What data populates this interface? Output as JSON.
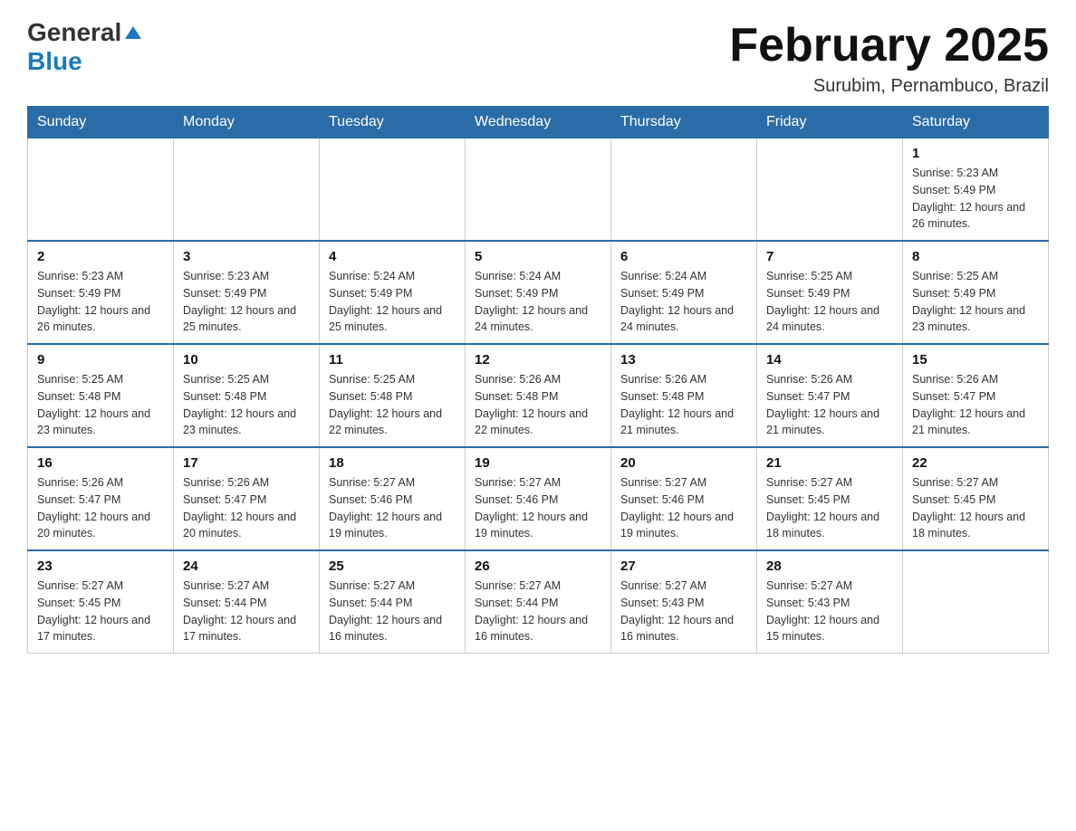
{
  "header": {
    "logo": {
      "general": "General",
      "blue": "Blue"
    },
    "title": "February 2025",
    "location": "Surubim, Pernambuco, Brazil"
  },
  "weekdays": [
    "Sunday",
    "Monday",
    "Tuesday",
    "Wednesday",
    "Thursday",
    "Friday",
    "Saturday"
  ],
  "weeks": [
    [
      {
        "day": "",
        "info": ""
      },
      {
        "day": "",
        "info": ""
      },
      {
        "day": "",
        "info": ""
      },
      {
        "day": "",
        "info": ""
      },
      {
        "day": "",
        "info": ""
      },
      {
        "day": "",
        "info": ""
      },
      {
        "day": "1",
        "info": "Sunrise: 5:23 AM\nSunset: 5:49 PM\nDaylight: 12 hours and 26 minutes."
      }
    ],
    [
      {
        "day": "2",
        "info": "Sunrise: 5:23 AM\nSunset: 5:49 PM\nDaylight: 12 hours and 26 minutes."
      },
      {
        "day": "3",
        "info": "Sunrise: 5:23 AM\nSunset: 5:49 PM\nDaylight: 12 hours and 25 minutes."
      },
      {
        "day": "4",
        "info": "Sunrise: 5:24 AM\nSunset: 5:49 PM\nDaylight: 12 hours and 25 minutes."
      },
      {
        "day": "5",
        "info": "Sunrise: 5:24 AM\nSunset: 5:49 PM\nDaylight: 12 hours and 24 minutes."
      },
      {
        "day": "6",
        "info": "Sunrise: 5:24 AM\nSunset: 5:49 PM\nDaylight: 12 hours and 24 minutes."
      },
      {
        "day": "7",
        "info": "Sunrise: 5:25 AM\nSunset: 5:49 PM\nDaylight: 12 hours and 24 minutes."
      },
      {
        "day": "8",
        "info": "Sunrise: 5:25 AM\nSunset: 5:49 PM\nDaylight: 12 hours and 23 minutes."
      }
    ],
    [
      {
        "day": "9",
        "info": "Sunrise: 5:25 AM\nSunset: 5:48 PM\nDaylight: 12 hours and 23 minutes."
      },
      {
        "day": "10",
        "info": "Sunrise: 5:25 AM\nSunset: 5:48 PM\nDaylight: 12 hours and 23 minutes."
      },
      {
        "day": "11",
        "info": "Sunrise: 5:25 AM\nSunset: 5:48 PM\nDaylight: 12 hours and 22 minutes."
      },
      {
        "day": "12",
        "info": "Sunrise: 5:26 AM\nSunset: 5:48 PM\nDaylight: 12 hours and 22 minutes."
      },
      {
        "day": "13",
        "info": "Sunrise: 5:26 AM\nSunset: 5:48 PM\nDaylight: 12 hours and 21 minutes."
      },
      {
        "day": "14",
        "info": "Sunrise: 5:26 AM\nSunset: 5:47 PM\nDaylight: 12 hours and 21 minutes."
      },
      {
        "day": "15",
        "info": "Sunrise: 5:26 AM\nSunset: 5:47 PM\nDaylight: 12 hours and 21 minutes."
      }
    ],
    [
      {
        "day": "16",
        "info": "Sunrise: 5:26 AM\nSunset: 5:47 PM\nDaylight: 12 hours and 20 minutes."
      },
      {
        "day": "17",
        "info": "Sunrise: 5:26 AM\nSunset: 5:47 PM\nDaylight: 12 hours and 20 minutes."
      },
      {
        "day": "18",
        "info": "Sunrise: 5:27 AM\nSunset: 5:46 PM\nDaylight: 12 hours and 19 minutes."
      },
      {
        "day": "19",
        "info": "Sunrise: 5:27 AM\nSunset: 5:46 PM\nDaylight: 12 hours and 19 minutes."
      },
      {
        "day": "20",
        "info": "Sunrise: 5:27 AM\nSunset: 5:46 PM\nDaylight: 12 hours and 19 minutes."
      },
      {
        "day": "21",
        "info": "Sunrise: 5:27 AM\nSunset: 5:45 PM\nDaylight: 12 hours and 18 minutes."
      },
      {
        "day": "22",
        "info": "Sunrise: 5:27 AM\nSunset: 5:45 PM\nDaylight: 12 hours and 18 minutes."
      }
    ],
    [
      {
        "day": "23",
        "info": "Sunrise: 5:27 AM\nSunset: 5:45 PM\nDaylight: 12 hours and 17 minutes."
      },
      {
        "day": "24",
        "info": "Sunrise: 5:27 AM\nSunset: 5:44 PM\nDaylight: 12 hours and 17 minutes."
      },
      {
        "day": "25",
        "info": "Sunrise: 5:27 AM\nSunset: 5:44 PM\nDaylight: 12 hours and 16 minutes."
      },
      {
        "day": "26",
        "info": "Sunrise: 5:27 AM\nSunset: 5:44 PM\nDaylight: 12 hours and 16 minutes."
      },
      {
        "day": "27",
        "info": "Sunrise: 5:27 AM\nSunset: 5:43 PM\nDaylight: 12 hours and 16 minutes."
      },
      {
        "day": "28",
        "info": "Sunrise: 5:27 AM\nSunset: 5:43 PM\nDaylight: 12 hours and 15 minutes."
      },
      {
        "day": "",
        "info": ""
      }
    ]
  ]
}
